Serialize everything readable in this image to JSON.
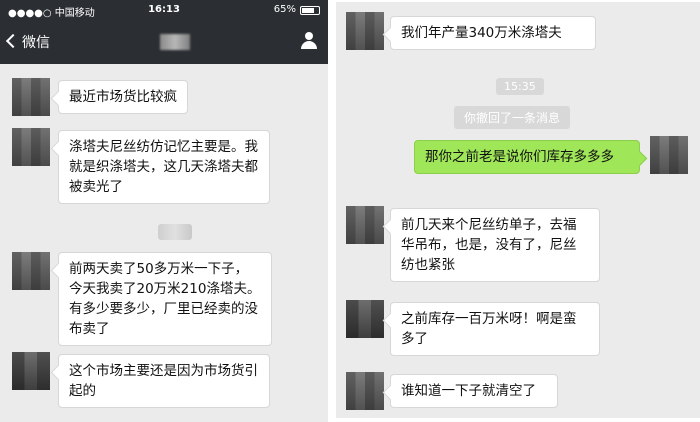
{
  "left": {
    "status": {
      "carrier": "●●●●○ 中国移动",
      "time": "16:13",
      "battery": "65%"
    },
    "nav": {
      "back_label": "微信"
    },
    "messages": [
      "最近市场货比较疯",
      "涤塔夫尼丝纺仿记忆主要是。我就是织涤塔夫，这几天涤塔夫都被卖光了",
      "前两天卖了50多万米一下子，今天我卖了20万米210涤塔夫。有多少要多少，厂里已经卖的没布卖了",
      "这个市场主要还是因为市场货引起的"
    ]
  },
  "right": {
    "messages_top": "我们年产量340万米涤塔夫",
    "time": "15:35",
    "recall_notice": "你撤回了一条消息",
    "mine": "那你之前老是说你们库存多多多",
    "messages": [
      "前几天来个尼丝纺单子，去福华吊布，也是，没有了，尼丝纺也紧张",
      "之前库存一百万米呀！啊是蛮多了",
      "谁知道一下子就清空了"
    ]
  }
}
